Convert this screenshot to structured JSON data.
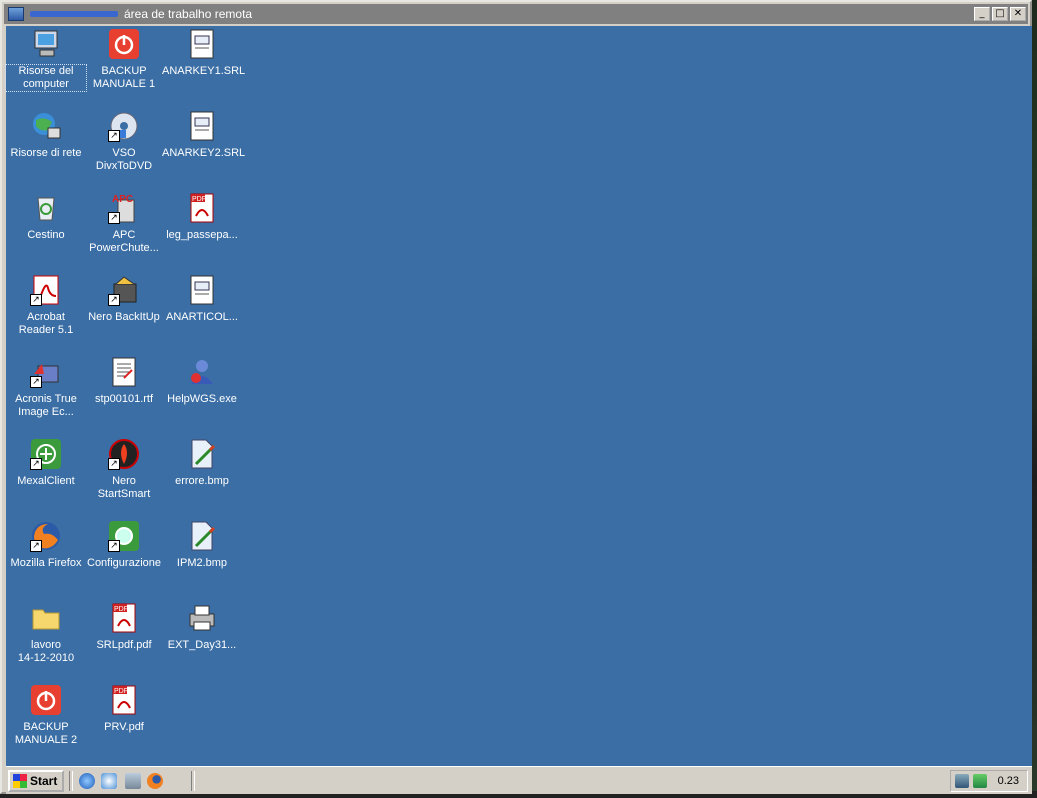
{
  "window": {
    "title": "área de trabalho remota"
  },
  "desktop": {
    "icons": [
      {
        "label": "Risorse del\ncomputer",
        "icon": "my-computer-icon"
      },
      {
        "label": "Risorse di rete",
        "icon": "network-icon"
      },
      {
        "label": "Cestino",
        "icon": "recycle-bin-icon"
      },
      {
        "label": "Acrobat\nReader 5.1",
        "icon": "acrobat-icon"
      },
      {
        "label": "Acronis True\nImage Ec...",
        "icon": "acronis-icon"
      },
      {
        "label": "MexalClient",
        "icon": "mexal-icon"
      },
      {
        "label": "Mozilla Firefox",
        "icon": "firefox-icon"
      },
      {
        "label": "lavoro\n14-12-2010",
        "icon": "folder-icon"
      },
      {
        "label": "BACKUP\nMANUALE 2",
        "icon": "power-icon"
      },
      {
        "label": "BACKUP\nMANUALE 1",
        "icon": "power-icon"
      },
      {
        "label": "VSO\nDivxToDVD",
        "icon": "dvd-icon"
      },
      {
        "label": "APC\nPowerChute...",
        "icon": "apc-icon"
      },
      {
        "label": "Nero BackItUp",
        "icon": "nero-backitup-icon"
      },
      {
        "label": "stp00101.rtf",
        "icon": "rtf-document-icon"
      },
      {
        "label": "Nero\nStartSmart",
        "icon": "nero-icon"
      },
      {
        "label": "Configurazione",
        "icon": "config-icon"
      },
      {
        "label": "SRLpdf.pdf",
        "icon": "pdf-icon"
      },
      {
        "label": "PRV.pdf",
        "icon": "pdf-icon"
      },
      {
        "label": "ANARKEY1.SRL",
        "icon": "srl-file-icon"
      },
      {
        "label": "ANARKEY2.SRL",
        "icon": "srl-file-icon"
      },
      {
        "label": "leg_passepa...",
        "icon": "pdf-icon"
      },
      {
        "label": "ANARTICOL...",
        "icon": "srl-file-icon"
      },
      {
        "label": "HelpWGS.exe",
        "icon": "help-user-icon"
      },
      {
        "label": "errore.bmp",
        "icon": "bitmap-icon"
      },
      {
        "label": "IPM2.bmp",
        "icon": "bitmap-icon"
      },
      {
        "label": "EXT_Day31...",
        "icon": "printer-icon"
      }
    ]
  },
  "taskbar": {
    "start_label": "Start",
    "quicklaunch": [
      "internet-explorer-icon",
      "outlook-express-icon",
      "show-desktop-icon",
      "firefox-icon"
    ],
    "tray": {
      "clock": "0.23",
      "icons": [
        "network-tray-icon",
        "tray-arrow-icon"
      ]
    }
  },
  "colors": {
    "desktop": "#3a6ea5",
    "titlebar_inactive": "#808080"
  }
}
